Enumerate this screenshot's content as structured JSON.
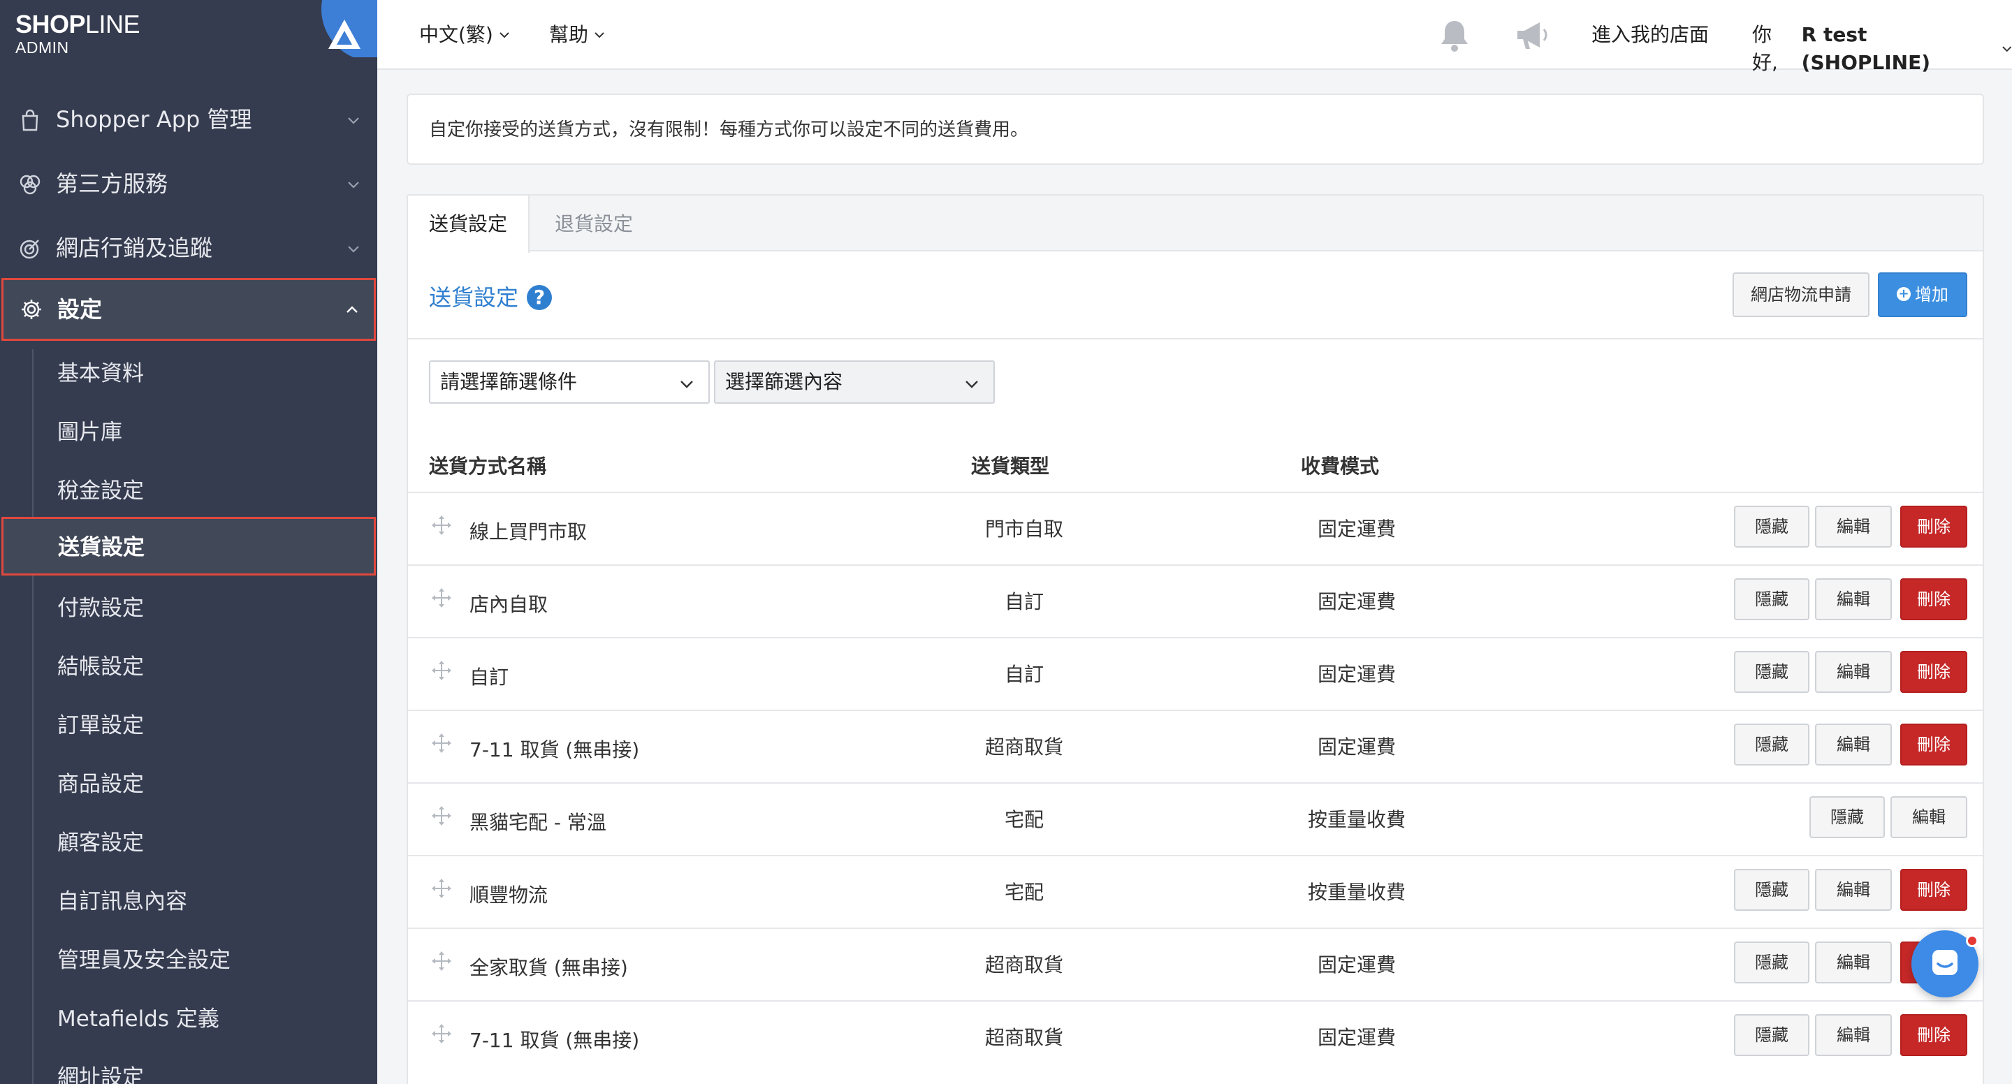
{
  "brand": {
    "logo_bold": "SHOP",
    "logo_thin": "LINE",
    "sub": "ADMIN"
  },
  "sidebar": {
    "menu": [
      {
        "label": "Shopper App 管理",
        "icon": "shopping-bag-icon"
      },
      {
        "label": "第三方服務",
        "icon": "services-icon"
      },
      {
        "label": "網店行銷及追蹤",
        "icon": "target-icon"
      },
      {
        "label": "設定",
        "icon": "gear-icon"
      }
    ],
    "sub_items": [
      "基本資料",
      "圖片庫",
      "稅金設定",
      "送貨設定",
      "付款設定",
      "結帳設定",
      "訂單設定",
      "商品設定",
      "顧客設定",
      "自訂訊息內容",
      "管理員及安全設定",
      "Metafields 定義",
      "網址設定"
    ]
  },
  "topbar": {
    "language": "中文(繁)",
    "help": "幫助",
    "store_link": "進入我的店面",
    "greeting": "你好,",
    "user": "R test (SHOPLINE)"
  },
  "info": "自定你接受的送貨方式，沒有限制！每種方式你可以設定不同的送貨費用。",
  "tabs": {
    "active": "送貨設定",
    "inactive": "退貨設定"
  },
  "section": {
    "title": "送貨設定",
    "help_symbol": "?",
    "apply_button": "網店物流申請",
    "add_button": "增加"
  },
  "filters": {
    "condition_placeholder": "請選擇篩選條件",
    "content_placeholder": "選擇篩選內容"
  },
  "table": {
    "headers": {
      "name": "送貨方式名稱",
      "type": "送貨類型",
      "fee": "收費模式"
    },
    "actions": {
      "hide": "隱藏",
      "edit": "編輯",
      "delete": "刪除"
    },
    "rows": [
      {
        "name": "線上買門市取",
        "type": "門市自取",
        "fee": "固定運費",
        "deletable": true
      },
      {
        "name": "店內自取",
        "type": "自訂",
        "fee": "固定運費",
        "deletable": true
      },
      {
        "name": "自訂",
        "type": "自訂",
        "fee": "固定運費",
        "deletable": true
      },
      {
        "name": "7-11 取貨 (無串接)",
        "type": "超商取貨",
        "fee": "固定運費",
        "deletable": true
      },
      {
        "name": "黑貓宅配 - 常溫",
        "type": "宅配",
        "fee": "按重量收費",
        "deletable": false
      },
      {
        "name": "順豐物流",
        "type": "宅配",
        "fee": "按重量收費",
        "deletable": true
      },
      {
        "name": "全家取貨 (無串接)",
        "type": "超商取貨",
        "fee": "固定運費",
        "deletable": true
      },
      {
        "name": "7-11 取貨 (無串接)",
        "type": "超商取貨",
        "fee": "固定運費",
        "deletable": true
      }
    ]
  }
}
